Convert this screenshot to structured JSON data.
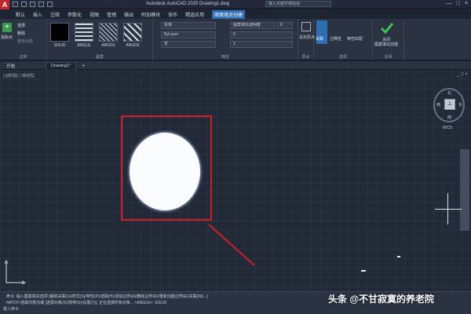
{
  "title_bar": {
    "logo": "A",
    "title": "Autodesk AutoCAD 2020  Drawing1.dwg",
    "search_placeholder": "键入关键字或短语",
    "controls": [
      "—",
      "□",
      "×"
    ]
  },
  "menu_tabs": [
    {
      "label": "默认"
    },
    {
      "label": "插入"
    },
    {
      "label": "注释"
    },
    {
      "label": "参数化"
    },
    {
      "label": "视图"
    },
    {
      "label": "管理"
    },
    {
      "label": "输出"
    },
    {
      "label": "附加模块"
    },
    {
      "label": "协作"
    },
    {
      "label": "精选应用"
    },
    {
      "label": "图案填充创建",
      "active": true
    }
  ],
  "ribbon": {
    "boundaries_panel": {
      "title": "边界",
      "pick_points": "拾取点",
      "select": "选择",
      "remove": "删除",
      "recreate": "重新创建"
    },
    "pattern_panel": {
      "title": "图案",
      "swatches": [
        {
          "label": "SOLID",
          "color": "#000000"
        },
        {
          "label": "ANGLE"
        },
        {
          "label": "ANSI31"
        },
        {
          "label": "ANSI32"
        }
      ]
    },
    "properties_panel": {
      "title": "特性",
      "pattern_type": "实体",
      "color": "ByLayer",
      "background": "无",
      "transparency_label": "图案填充透明度",
      "transparency_value": "0",
      "angle_value": "0",
      "scale_value": "1"
    },
    "origin_panel": {
      "title": "原点",
      "set_origin": "设定原点"
    },
    "options_panel": {
      "title": "选项",
      "associative": "关联",
      "annotative": "注释性",
      "match": "特性匹配"
    },
    "close_panel": {
      "title": "关闭",
      "close_label": "关闭\n图案填充创建"
    }
  },
  "doc_tabs": [
    {
      "label": "开始"
    },
    {
      "label": "Drawing1*",
      "active": true
    }
  ],
  "viewport": {
    "label": "[-][俯视][二维线框]",
    "controls": "_ □ ×"
  },
  "viewcube": {
    "face": "上",
    "north": "北",
    "south": "南",
    "east": "东",
    "west": "西",
    "wcs": "WCS"
  },
  "command_line": {
    "history": "命令: *取消*",
    "line1": "命令: 输入图案填充选项 [解除关联(U)/样式(S)/特性(P)/选取(H)/添加边界(A)/删除边界(R)/重新创建边界(E)/关联(N)/...]",
    "line2": "HATCH 拾取内部点或 [选择对象(S)/放弃(U)/设置(T)]: 正在选择所有对象... <ANGLE>: SOLID",
    "input_placeholder": "键入命令"
  },
  "watermark": "头条 @不甘寂寞的养老院",
  "colors": {
    "background": "#1e2532",
    "ribbon": "#2b3242",
    "accent": "#2d6fb4",
    "highlight_box": "#d01f24",
    "hatch_fill": "#fbfcfe"
  }
}
